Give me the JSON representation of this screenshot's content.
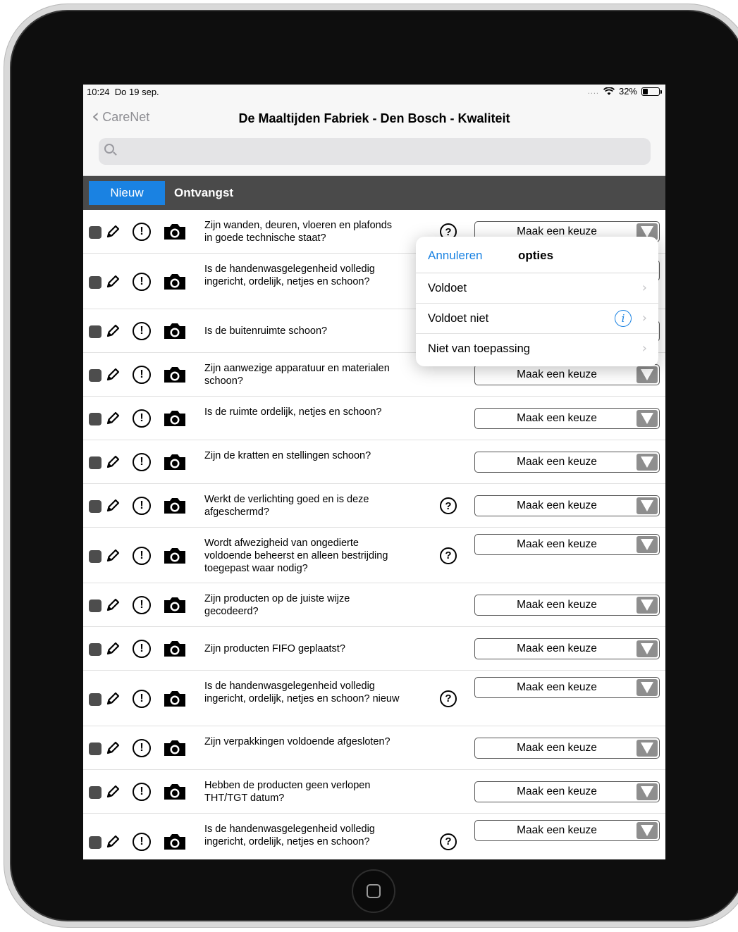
{
  "status": {
    "time": "10:24",
    "date": "Do 19 sep.",
    "signal": "....",
    "battery": "32%",
    "battery_level": 0.32
  },
  "nav": {
    "back_label": "CareNet",
    "title": "De Maaltijden Fabriek - Den Bosch - Kwaliteit"
  },
  "search": {
    "placeholder": "",
    "value": ""
  },
  "tabs": {
    "new_label": "Nieuw",
    "section_title": "Ontvangst"
  },
  "select_default": "Maak een keuze",
  "rows": [
    {
      "question": "Zijn wanden, deuren, vloeren en plafonds in goede technische staat?",
      "help": true
    },
    {
      "question": "Is de handenwasgelegenheid volledig ingericht, ordelijk, netjes en schoon?",
      "help": false
    },
    {
      "question": "Is de buitenruimte schoon?",
      "help": false
    },
    {
      "question": "Zijn aanwezige apparatuur en materialen schoon?",
      "help": false
    },
    {
      "question": "Is de ruimte ordelijk, netjes en schoon?",
      "help": false
    },
    {
      "question": "Zijn de kratten en stellingen schoon?",
      "help": false
    },
    {
      "question": "Werkt de verlichting goed en is deze afgeschermd?",
      "help": true
    },
    {
      "question": "Wordt afwezigheid van ongedierte voldoende beheerst en alleen bestrijding toegepast waar nodig?",
      "help": true
    },
    {
      "question": "Zijn producten op de juiste wijze gecodeerd?",
      "help": false
    },
    {
      "question": "Zijn producten FIFO geplaatst?",
      "help": false
    },
    {
      "question": "Is de handenwasgelegenheid volledig ingericht, ordelijk, netjes en schoon? nieuw",
      "help": true
    },
    {
      "question": "Zijn verpakkingen voldoende afgesloten?",
      "help": false
    },
    {
      "question": "Hebben de producten geen verlopen THT/TGT datum?",
      "help": false
    },
    {
      "question": "Is de handenwasgelegenheid volledig ingericht, ordelijk, netjes en schoon?",
      "help": true
    }
  ],
  "popover": {
    "cancel_label": "Annuleren",
    "title": "opties",
    "options": [
      {
        "label": "Voldoet",
        "info": false
      },
      {
        "label": "Voldoet niet",
        "info": true
      },
      {
        "label": "Niet van toepassing",
        "info": false
      }
    ]
  },
  "colors": {
    "accent": "#1a82e2",
    "tabbar": "#4a4a4a",
    "select_arrow": "#8e8e8e"
  },
  "icons": [
    "checkbox-icon",
    "pencil-icon",
    "alert-icon",
    "camera-icon",
    "help-icon",
    "chevron-down-icon",
    "chevron-right-icon",
    "info-icon",
    "search-icon",
    "back-chevron-icon"
  ]
}
